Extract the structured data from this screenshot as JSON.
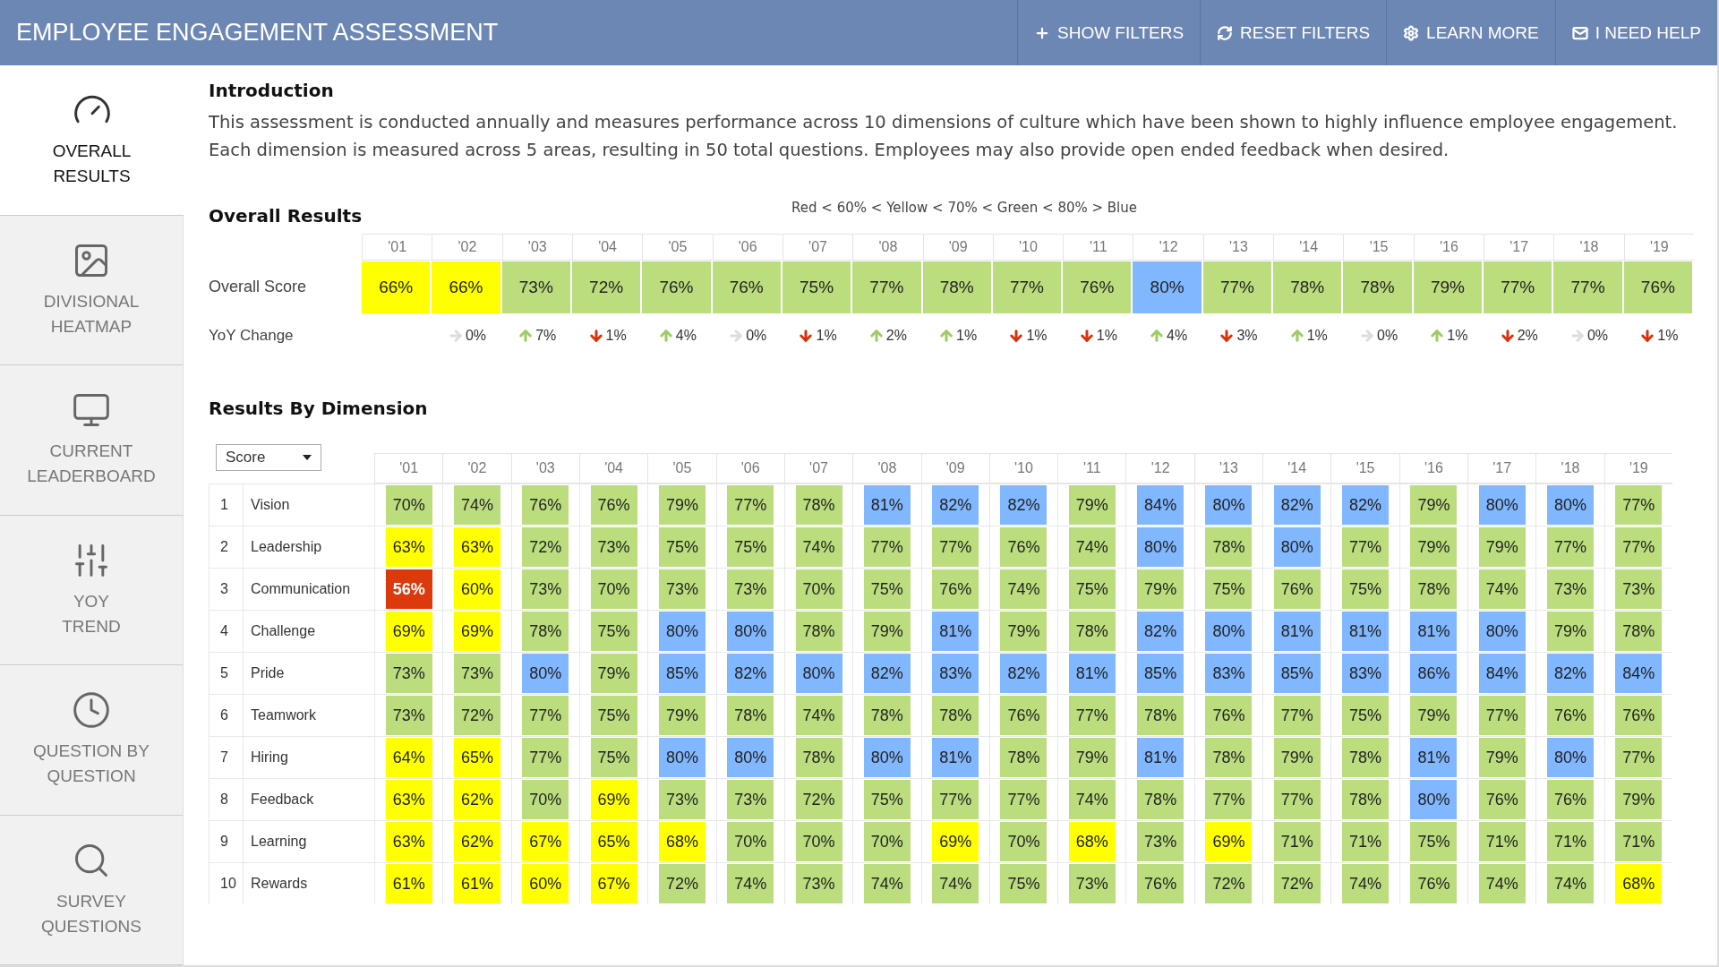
{
  "header": {
    "title": "EMPLOYEE ENGAGEMENT ASSESSMENT",
    "actions": [
      {
        "label": "SHOW FILTERS",
        "kind": "plus"
      },
      {
        "label": "RESET FILTERS",
        "kind": "refresh"
      },
      {
        "label": "LEARN MORE",
        "kind": "gear"
      },
      {
        "label": "I NEED HELP",
        "kind": "mail"
      }
    ]
  },
  "sidebar": {
    "items": [
      {
        "lines": [
          "OVERALL",
          "RESULTS"
        ],
        "kind": "gauge",
        "selected": true
      },
      {
        "lines": [
          "DIVISIONAL",
          "HEATMAP"
        ],
        "kind": "image",
        "selected": false
      },
      {
        "lines": [
          "CURRENT",
          "LEADERBOARD"
        ],
        "kind": "monitor",
        "selected": false
      },
      {
        "lines": [
          "YOY",
          "TREND"
        ],
        "kind": "sliders",
        "selected": false
      },
      {
        "lines": [
          "QUESTION BY",
          "QUESTION"
        ],
        "kind": "clock",
        "selected": false
      },
      {
        "lines": [
          "SURVEY",
          "QUESTIONS"
        ],
        "kind": "search",
        "selected": false
      }
    ]
  },
  "introduction": {
    "title": "Introduction",
    "text": "This assessment is conducted annually and measures performance across 10 dimensions of culture which have been shown to highly influence employee engagement.  Each dimension is measured across 5 areas, resulting in 50 total questions.  Employees may also provide open ended feedback when desired."
  },
  "overall": {
    "title": "Overall Results",
    "legend": "Red < 60% < Yellow < 70% < Green < 80% > Blue",
    "years": [
      "'01",
      "'02",
      "'03",
      "'04",
      "'05",
      "'06",
      "'07",
      "'08",
      "'09",
      "'10",
      "'11",
      "'12",
      "'13",
      "'14",
      "'15",
      "'16",
      "'17",
      "'18",
      "'19"
    ],
    "score_label": "Overall Score",
    "scores": [
      {
        "value": "66%",
        "color": "#ffff00"
      },
      {
        "value": "66%",
        "color": "#ffff00"
      },
      {
        "value": "73%",
        "color": "#bbdd7d"
      },
      {
        "value": "72%",
        "color": "#bbdd7d"
      },
      {
        "value": "76%",
        "color": "#bbdd7d"
      },
      {
        "value": "76%",
        "color": "#bbdd7d"
      },
      {
        "value": "75%",
        "color": "#bbdd7d"
      },
      {
        "value": "77%",
        "color": "#bbdd7d"
      },
      {
        "value": "78%",
        "color": "#bbdd7d"
      },
      {
        "value": "77%",
        "color": "#bbdd7d"
      },
      {
        "value": "76%",
        "color": "#bbdd7d"
      },
      {
        "value": "80%",
        "color": "#80b7ff"
      },
      {
        "value": "77%",
        "color": "#bbdd7d"
      },
      {
        "value": "78%",
        "color": "#bbdd7d"
      },
      {
        "value": "78%",
        "color": "#bbdd7d"
      },
      {
        "value": "79%",
        "color": "#bbdd7d"
      },
      {
        "value": "77%",
        "color": "#bbdd7d"
      },
      {
        "value": "77%",
        "color": "#bbdd7d"
      },
      {
        "value": "76%",
        "color": "#bbdd7d"
      }
    ],
    "yoy_label": "YoY Change",
    "yoy": [
      {
        "kind": "flat",
        "value": "0%"
      },
      {
        "kind": "up",
        "value": "7%"
      },
      {
        "kind": "down",
        "value": "1%"
      },
      {
        "kind": "up",
        "value": "4%"
      },
      {
        "kind": "flat",
        "value": "0%"
      },
      {
        "kind": "down",
        "value": "1%"
      },
      {
        "kind": "up",
        "value": "2%"
      },
      {
        "kind": "up",
        "value": "1%"
      },
      {
        "kind": "down",
        "value": "1%"
      },
      {
        "kind": "down",
        "value": "1%"
      },
      {
        "kind": "up",
        "value": "4%"
      },
      {
        "kind": "down",
        "value": "3%"
      },
      {
        "kind": "up",
        "value": "1%"
      },
      {
        "kind": "flat",
        "value": "0%"
      },
      {
        "kind": "up",
        "value": "1%"
      },
      {
        "kind": "down",
        "value": "2%"
      },
      {
        "kind": "flat",
        "value": "0%"
      },
      {
        "kind": "down",
        "value": "1%"
      }
    ]
  },
  "dimensions": {
    "title": "Results By Dimension",
    "dropdown": "Score",
    "years": [
      "'01",
      "'02",
      "'03",
      "'04",
      "'05",
      "'06",
      "'07",
      "'08",
      "'09",
      "'10",
      "'11",
      "'12",
      "'13",
      "'14",
      "'15",
      "'16",
      "'17",
      "'18",
      "'19"
    ],
    "rows": [
      {
        "number": "1",
        "name": "Vision",
        "cells": [
          {
            "value": "70%",
            "color": "#bbdd7d"
          },
          {
            "value": "74%",
            "color": "#bbdd7d"
          },
          {
            "value": "76%",
            "color": "#bbdd7d"
          },
          {
            "value": "76%",
            "color": "#bbdd7d"
          },
          {
            "value": "79%",
            "color": "#bbdd7d"
          },
          {
            "value": "77%",
            "color": "#bbdd7d"
          },
          {
            "value": "78%",
            "color": "#bbdd7d"
          },
          {
            "value": "81%",
            "color": "#80b7ff"
          },
          {
            "value": "82%",
            "color": "#80b7ff"
          },
          {
            "value": "82%",
            "color": "#80b7ff"
          },
          {
            "value": "79%",
            "color": "#bbdd7d"
          },
          {
            "value": "84%",
            "color": "#80b7ff"
          },
          {
            "value": "80%",
            "color": "#80b7ff"
          },
          {
            "value": "82%",
            "color": "#80b7ff"
          },
          {
            "value": "82%",
            "color": "#80b7ff"
          },
          {
            "value": "79%",
            "color": "#bbdd7d"
          },
          {
            "value": "80%",
            "color": "#80b7ff"
          },
          {
            "value": "80%",
            "color": "#80b7ff"
          },
          {
            "value": "77%",
            "color": "#bbdd7d"
          }
        ]
      },
      {
        "number": "2",
        "name": "Leadership",
        "cells": [
          {
            "value": "63%",
            "color": "#ffff00"
          },
          {
            "value": "63%",
            "color": "#ffff00"
          },
          {
            "value": "72%",
            "color": "#bbdd7d"
          },
          {
            "value": "73%",
            "color": "#bbdd7d"
          },
          {
            "value": "75%",
            "color": "#bbdd7d"
          },
          {
            "value": "75%",
            "color": "#bbdd7d"
          },
          {
            "value": "74%",
            "color": "#bbdd7d"
          },
          {
            "value": "77%",
            "color": "#bbdd7d"
          },
          {
            "value": "77%",
            "color": "#bbdd7d"
          },
          {
            "value": "76%",
            "color": "#bbdd7d"
          },
          {
            "value": "74%",
            "color": "#bbdd7d"
          },
          {
            "value": "80%",
            "color": "#80b7ff"
          },
          {
            "value": "78%",
            "color": "#bbdd7d"
          },
          {
            "value": "80%",
            "color": "#80b7ff"
          },
          {
            "value": "77%",
            "color": "#bbdd7d"
          },
          {
            "value": "79%",
            "color": "#bbdd7d"
          },
          {
            "value": "79%",
            "color": "#bbdd7d"
          },
          {
            "value": "77%",
            "color": "#bbdd7d"
          },
          {
            "value": "77%",
            "color": "#bbdd7d"
          }
        ]
      },
      {
        "number": "3",
        "name": "Communication",
        "cells": [
          {
            "value": "56%",
            "color": "#dc3a0c"
          },
          {
            "value": "60%",
            "color": "#ffff00"
          },
          {
            "value": "73%",
            "color": "#bbdd7d"
          },
          {
            "value": "70%",
            "color": "#bbdd7d"
          },
          {
            "value": "73%",
            "color": "#bbdd7d"
          },
          {
            "value": "73%",
            "color": "#bbdd7d"
          },
          {
            "value": "70%",
            "color": "#bbdd7d"
          },
          {
            "value": "75%",
            "color": "#bbdd7d"
          },
          {
            "value": "76%",
            "color": "#bbdd7d"
          },
          {
            "value": "74%",
            "color": "#bbdd7d"
          },
          {
            "value": "75%",
            "color": "#bbdd7d"
          },
          {
            "value": "79%",
            "color": "#bbdd7d"
          },
          {
            "value": "75%",
            "color": "#bbdd7d"
          },
          {
            "value": "76%",
            "color": "#bbdd7d"
          },
          {
            "value": "75%",
            "color": "#bbdd7d"
          },
          {
            "value": "78%",
            "color": "#bbdd7d"
          },
          {
            "value": "74%",
            "color": "#bbdd7d"
          },
          {
            "value": "73%",
            "color": "#bbdd7d"
          },
          {
            "value": "73%",
            "color": "#bbdd7d"
          }
        ]
      },
      {
        "number": "4",
        "name": "Challenge",
        "cells": [
          {
            "value": "69%",
            "color": "#ffff00"
          },
          {
            "value": "69%",
            "color": "#ffff00"
          },
          {
            "value": "78%",
            "color": "#bbdd7d"
          },
          {
            "value": "75%",
            "color": "#bbdd7d"
          },
          {
            "value": "80%",
            "color": "#80b7ff"
          },
          {
            "value": "80%",
            "color": "#80b7ff"
          },
          {
            "value": "78%",
            "color": "#bbdd7d"
          },
          {
            "value": "79%",
            "color": "#bbdd7d"
          },
          {
            "value": "81%",
            "color": "#80b7ff"
          },
          {
            "value": "79%",
            "color": "#bbdd7d"
          },
          {
            "value": "78%",
            "color": "#bbdd7d"
          },
          {
            "value": "82%",
            "color": "#80b7ff"
          },
          {
            "value": "80%",
            "color": "#80b7ff"
          },
          {
            "value": "81%",
            "color": "#80b7ff"
          },
          {
            "value": "81%",
            "color": "#80b7ff"
          },
          {
            "value": "81%",
            "color": "#80b7ff"
          },
          {
            "value": "80%",
            "color": "#80b7ff"
          },
          {
            "value": "79%",
            "color": "#bbdd7d"
          },
          {
            "value": "78%",
            "color": "#bbdd7d"
          }
        ]
      },
      {
        "number": "5",
        "name": "Pride",
        "cells": [
          {
            "value": "73%",
            "color": "#bbdd7d"
          },
          {
            "value": "73%",
            "color": "#bbdd7d"
          },
          {
            "value": "80%",
            "color": "#80b7ff"
          },
          {
            "value": "79%",
            "color": "#bbdd7d"
          },
          {
            "value": "85%",
            "color": "#80b7ff"
          },
          {
            "value": "82%",
            "color": "#80b7ff"
          },
          {
            "value": "80%",
            "color": "#80b7ff"
          },
          {
            "value": "82%",
            "color": "#80b7ff"
          },
          {
            "value": "83%",
            "color": "#80b7ff"
          },
          {
            "value": "82%",
            "color": "#80b7ff"
          },
          {
            "value": "81%",
            "color": "#80b7ff"
          },
          {
            "value": "85%",
            "color": "#80b7ff"
          },
          {
            "value": "83%",
            "color": "#80b7ff"
          },
          {
            "value": "85%",
            "color": "#80b7ff"
          },
          {
            "value": "83%",
            "color": "#80b7ff"
          },
          {
            "value": "86%",
            "color": "#80b7ff"
          },
          {
            "value": "84%",
            "color": "#80b7ff"
          },
          {
            "value": "82%",
            "color": "#80b7ff"
          },
          {
            "value": "84%",
            "color": "#80b7ff"
          }
        ]
      },
      {
        "number": "6",
        "name": "Teamwork",
        "cells": [
          {
            "value": "73%",
            "color": "#bbdd7d"
          },
          {
            "value": "72%",
            "color": "#bbdd7d"
          },
          {
            "value": "77%",
            "color": "#bbdd7d"
          },
          {
            "value": "75%",
            "color": "#bbdd7d"
          },
          {
            "value": "79%",
            "color": "#bbdd7d"
          },
          {
            "value": "78%",
            "color": "#bbdd7d"
          },
          {
            "value": "74%",
            "color": "#bbdd7d"
          },
          {
            "value": "78%",
            "color": "#bbdd7d"
          },
          {
            "value": "78%",
            "color": "#bbdd7d"
          },
          {
            "value": "76%",
            "color": "#bbdd7d"
          },
          {
            "value": "77%",
            "color": "#bbdd7d"
          },
          {
            "value": "78%",
            "color": "#bbdd7d"
          },
          {
            "value": "76%",
            "color": "#bbdd7d"
          },
          {
            "value": "77%",
            "color": "#bbdd7d"
          },
          {
            "value": "75%",
            "color": "#bbdd7d"
          },
          {
            "value": "79%",
            "color": "#bbdd7d"
          },
          {
            "value": "77%",
            "color": "#bbdd7d"
          },
          {
            "value": "76%",
            "color": "#bbdd7d"
          },
          {
            "value": "76%",
            "color": "#bbdd7d"
          }
        ]
      },
      {
        "number": "7",
        "name": "Hiring",
        "cells": [
          {
            "value": "64%",
            "color": "#ffff00"
          },
          {
            "value": "65%",
            "color": "#ffff00"
          },
          {
            "value": "77%",
            "color": "#bbdd7d"
          },
          {
            "value": "75%",
            "color": "#bbdd7d"
          },
          {
            "value": "80%",
            "color": "#80b7ff"
          },
          {
            "value": "80%",
            "color": "#80b7ff"
          },
          {
            "value": "78%",
            "color": "#bbdd7d"
          },
          {
            "value": "80%",
            "color": "#80b7ff"
          },
          {
            "value": "81%",
            "color": "#80b7ff"
          },
          {
            "value": "78%",
            "color": "#bbdd7d"
          },
          {
            "value": "79%",
            "color": "#bbdd7d"
          },
          {
            "value": "81%",
            "color": "#80b7ff"
          },
          {
            "value": "78%",
            "color": "#bbdd7d"
          },
          {
            "value": "79%",
            "color": "#bbdd7d"
          },
          {
            "value": "78%",
            "color": "#bbdd7d"
          },
          {
            "value": "81%",
            "color": "#80b7ff"
          },
          {
            "value": "79%",
            "color": "#bbdd7d"
          },
          {
            "value": "80%",
            "color": "#80b7ff"
          },
          {
            "value": "77%",
            "color": "#bbdd7d"
          }
        ]
      },
      {
        "number": "8",
        "name": "Feedback",
        "cells": [
          {
            "value": "63%",
            "color": "#ffff00"
          },
          {
            "value": "62%",
            "color": "#ffff00"
          },
          {
            "value": "70%",
            "color": "#bbdd7d"
          },
          {
            "value": "69%",
            "color": "#ffff00"
          },
          {
            "value": "73%",
            "color": "#bbdd7d"
          },
          {
            "value": "73%",
            "color": "#bbdd7d"
          },
          {
            "value": "72%",
            "color": "#bbdd7d"
          },
          {
            "value": "75%",
            "color": "#bbdd7d"
          },
          {
            "value": "77%",
            "color": "#bbdd7d"
          },
          {
            "value": "77%",
            "color": "#bbdd7d"
          },
          {
            "value": "74%",
            "color": "#bbdd7d"
          },
          {
            "value": "78%",
            "color": "#bbdd7d"
          },
          {
            "value": "77%",
            "color": "#bbdd7d"
          },
          {
            "value": "77%",
            "color": "#bbdd7d"
          },
          {
            "value": "78%",
            "color": "#bbdd7d"
          },
          {
            "value": "80%",
            "color": "#80b7ff"
          },
          {
            "value": "76%",
            "color": "#bbdd7d"
          },
          {
            "value": "76%",
            "color": "#bbdd7d"
          },
          {
            "value": "79%",
            "color": "#bbdd7d"
          }
        ]
      },
      {
        "number": "9",
        "name": "Learning",
        "cells": [
          {
            "value": "63%",
            "color": "#ffff00"
          },
          {
            "value": "62%",
            "color": "#ffff00"
          },
          {
            "value": "67%",
            "color": "#ffff00"
          },
          {
            "value": "65%",
            "color": "#ffff00"
          },
          {
            "value": "68%",
            "color": "#ffff00"
          },
          {
            "value": "70%",
            "color": "#bbdd7d"
          },
          {
            "value": "70%",
            "color": "#bbdd7d"
          },
          {
            "value": "70%",
            "color": "#bbdd7d"
          },
          {
            "value": "69%",
            "color": "#ffff00"
          },
          {
            "value": "70%",
            "color": "#bbdd7d"
          },
          {
            "value": "68%",
            "color": "#ffff00"
          },
          {
            "value": "73%",
            "color": "#bbdd7d"
          },
          {
            "value": "69%",
            "color": "#ffff00"
          },
          {
            "value": "71%",
            "color": "#bbdd7d"
          },
          {
            "value": "71%",
            "color": "#bbdd7d"
          },
          {
            "value": "75%",
            "color": "#bbdd7d"
          },
          {
            "value": "71%",
            "color": "#bbdd7d"
          },
          {
            "value": "71%",
            "color": "#bbdd7d"
          },
          {
            "value": "71%",
            "color": "#bbdd7d"
          }
        ]
      },
      {
        "number": "10",
        "name": "Rewards",
        "cells": [
          {
            "value": "61%",
            "color": "#ffff00"
          },
          {
            "value": "61%",
            "color": "#ffff00"
          },
          {
            "value": "60%",
            "color": "#ffff00"
          },
          {
            "value": "67%",
            "color": "#ffff00"
          },
          {
            "value": "72%",
            "color": "#bbdd7d"
          },
          {
            "value": "74%",
            "color": "#bbdd7d"
          },
          {
            "value": "73%",
            "color": "#bbdd7d"
          },
          {
            "value": "74%",
            "color": "#bbdd7d"
          },
          {
            "value": "74%",
            "color": "#bbdd7d"
          },
          {
            "value": "75%",
            "color": "#bbdd7d"
          },
          {
            "value": "73%",
            "color": "#bbdd7d"
          },
          {
            "value": "76%",
            "color": "#bbdd7d"
          },
          {
            "value": "72%",
            "color": "#bbdd7d"
          },
          {
            "value": "72%",
            "color": "#bbdd7d"
          },
          {
            "value": "74%",
            "color": "#bbdd7d"
          },
          {
            "value": "76%",
            "color": "#bbdd7d"
          },
          {
            "value": "74%",
            "color": "#bbdd7d"
          },
          {
            "value": "74%",
            "color": "#bbdd7d"
          },
          {
            "value": "68%",
            "color": "#ffff00"
          }
        ]
      }
    ]
  }
}
